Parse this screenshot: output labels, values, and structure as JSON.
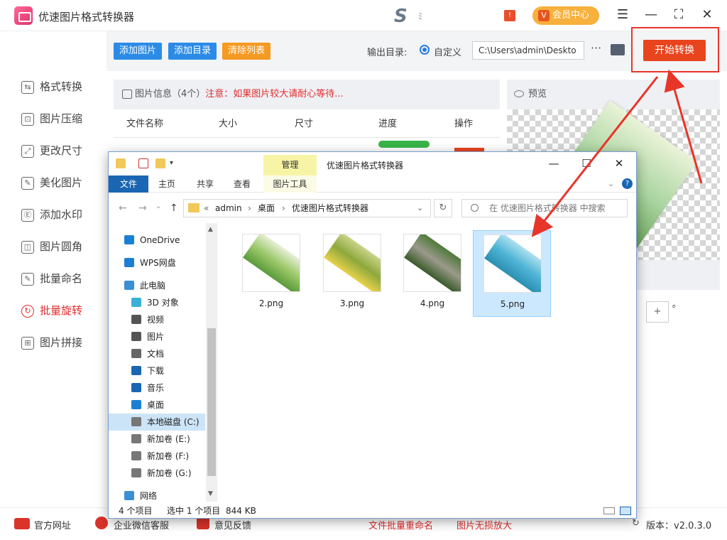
{
  "app": {
    "title": "优速图片格式转换器",
    "vip_label": "会员中心",
    "vip_icon": "V",
    "badge": "!"
  },
  "toolbar": {
    "add_image": "添加图片",
    "add_dir": "添加目录",
    "clear_list": "清除列表",
    "output_label": "输出目录:",
    "custom_label": "自定义",
    "path_value": "C:\\Users\\admin\\Deskto",
    "more": "···",
    "start": "开始转换"
  },
  "sidebar": {
    "items": [
      {
        "label": "格式转换",
        "icon": "swap-icon"
      },
      {
        "label": "图片压缩",
        "icon": "compress-icon"
      },
      {
        "label": "更改尺寸",
        "icon": "resize-icon"
      },
      {
        "label": "美化图片",
        "icon": "beautify-icon"
      },
      {
        "label": "添加水印",
        "icon": "watermark-icon"
      },
      {
        "label": "图片圆角",
        "icon": "round-corner-icon"
      },
      {
        "label": "批量命名",
        "icon": "rename-icon"
      },
      {
        "label": "批量旋转",
        "icon": "rotate-icon",
        "active": true
      },
      {
        "label": "图片拼接",
        "icon": "stitch-icon"
      }
    ]
  },
  "info": {
    "title": "图片信息（4个）",
    "warning": "注意：如果图片较大请耐心等待..."
  },
  "table": {
    "headers": [
      "文件名称",
      "大小",
      "尺寸",
      "进度",
      "操作"
    ]
  },
  "preview": {
    "label": "预览"
  },
  "rotate": {
    "minus": "+",
    "unit": "°"
  },
  "footer": {
    "website": "官方网址",
    "wechat": "企业微信客服",
    "feedback": "意见反馈",
    "rename_link": "文件批量重命名",
    "enlarge_link": "图片无损放大",
    "version": "版本：v2.0.3.0"
  },
  "explorer": {
    "title": "优速图片格式转换器",
    "manage": "管理",
    "tabs": [
      "文件",
      "主页",
      "共享",
      "查看",
      "图片工具"
    ],
    "breadcrumb": [
      "«",
      "admin",
      "›",
      "桌面",
      "›",
      "优速图片格式转换器"
    ],
    "search_placeholder": "在 优速图片格式转换器 中搜索",
    "nav": [
      {
        "label": "OneDrive",
        "icon": "cloud-icon"
      },
      {
        "label": "WPS网盘",
        "icon": "cloud-icon"
      },
      {
        "label": "此电脑",
        "icon": "computer-icon"
      },
      {
        "label": "3D 对象",
        "icon": "cube-icon"
      },
      {
        "label": "视频",
        "icon": "video-icon"
      },
      {
        "label": "图片",
        "icon": "picture-icon"
      },
      {
        "label": "文档",
        "icon": "document-icon"
      },
      {
        "label": "下载",
        "icon": "download-icon"
      },
      {
        "label": "音乐",
        "icon": "music-icon"
      },
      {
        "label": "桌面",
        "icon": "desktop-icon"
      },
      {
        "label": "本地磁盘 (C:)",
        "icon": "drive-icon",
        "selected": true
      },
      {
        "label": "新加卷 (E:)",
        "icon": "drive-icon"
      },
      {
        "label": "新加卷 (F:)",
        "icon": "drive-icon"
      },
      {
        "label": "新加卷 (G:)",
        "icon": "drive-icon"
      },
      {
        "label": "网络",
        "icon": "network-icon"
      }
    ],
    "files": [
      {
        "name": "2.png",
        "colors": [
          "#e8f0d8",
          "#9cc86a",
          "#5a9a3a"
        ]
      },
      {
        "name": "3.png",
        "colors": [
          "#c9d48a",
          "#8ea83c",
          "#e6d24a"
        ]
      },
      {
        "name": "4.png",
        "colors": [
          "#4f7a3a",
          "#9a9a8a",
          "#3a5a2a"
        ]
      },
      {
        "name": "5.png",
        "colors": [
          "#aee0f0",
          "#4fb4d6",
          "#2a8fb0"
        ],
        "selected": true
      }
    ],
    "status": {
      "count": "4 个项目",
      "selected": "选中 1 个项目",
      "size": "844 KB"
    }
  },
  "colors": {
    "accent": "#e8441e",
    "blue_btn": "#2b8be6",
    "orange_btn": "#f59a23"
  }
}
